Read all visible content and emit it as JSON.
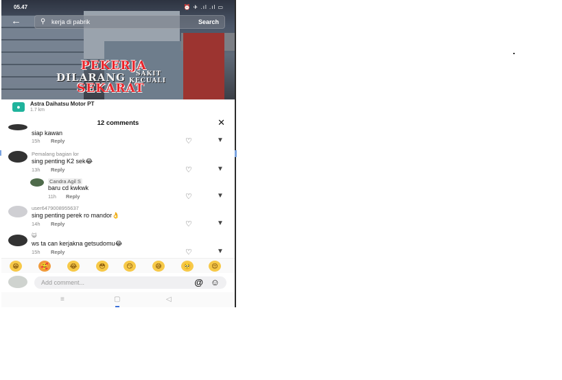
{
  "status_bar": {
    "time": "05.47",
    "icons_text": "⏰ ✈ .ıl .ıl ▭"
  },
  "search": {
    "query": "kerja di pabrik",
    "button_label": "Search"
  },
  "video_overlay": {
    "line1": "PEKERJA",
    "line2": "DILARANG",
    "line3a": "SAKIT",
    "line3b": "KECUALI",
    "line4": "SEKARAT"
  },
  "location": {
    "name": "Astra Daihatsu Motor PT",
    "distance": "1.7 km"
  },
  "comments_panel": {
    "title": "12 comments",
    "comments": [
      {
        "user": "",
        "text": "siap kawan",
        "time": "15h",
        "reply_label": "Reply"
      },
      {
        "user": "Pemalang bagian lor",
        "text": "sing penting K2 sek😂",
        "time": "13h",
        "reply_label": "Reply"
      },
      {
        "user": "Candra Agil S",
        "text": "baru cd kwkwk",
        "time": "11h",
        "reply_label": "Reply"
      },
      {
        "user": "user6479008955637",
        "text": "sing penting perek ro mandor👌",
        "time": "14h",
        "reply_label": "Reply"
      },
      {
        "user": "😺",
        "text": "ws ta can kerjakna getsudomu😂",
        "time": "15h",
        "reply_label": "Reply"
      }
    ]
  },
  "emoji_bar": [
    "😁",
    "🥰",
    "😂",
    "😳",
    "😏",
    "😅",
    "🥺",
    "😌"
  ],
  "composer": {
    "placeholder": "Add comment...",
    "at_symbol": "@",
    "emoji_symbol": "☺"
  },
  "navigation": {
    "menu": "≡",
    "home": "▢",
    "back": "◁"
  }
}
